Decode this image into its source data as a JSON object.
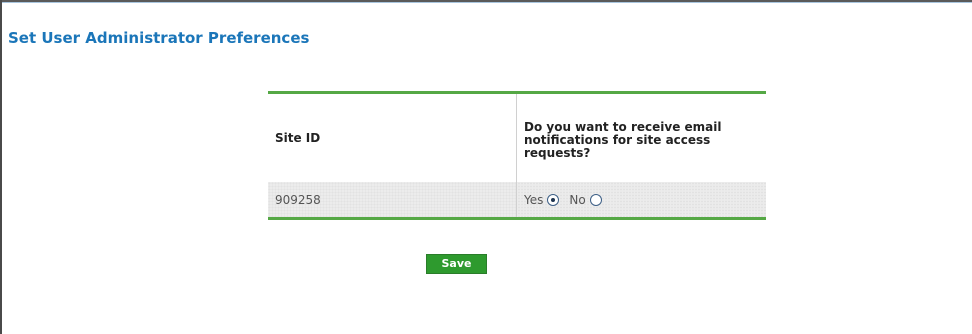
{
  "page": {
    "title": "Set User Administrator Preferences"
  },
  "table": {
    "headers": {
      "site_id": "Site ID",
      "question": "Do you want to receive email notifications for site access requests?"
    },
    "rows": [
      {
        "site_id": "909258",
        "options": {
          "yes_label": "Yes",
          "no_label": "No",
          "selected": "Yes"
        }
      }
    ]
  },
  "actions": {
    "save_label": "Save"
  },
  "colors": {
    "title": "#1b76b9",
    "accent_line": "#55a845",
    "save_button": "#2e9a2e"
  }
}
